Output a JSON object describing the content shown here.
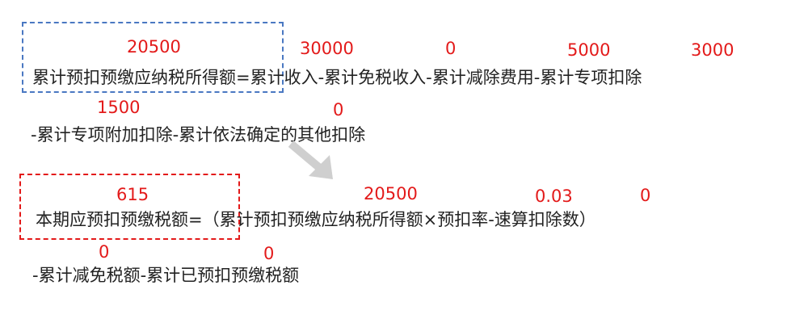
{
  "formula1": {
    "line1": "累计预扣预缴应纳税所得额=累计收入-累计免税收入-累计减除费用-累计专项扣除",
    "line2": "-累计专项附加扣除-累计依法确定的其他扣除",
    "values": {
      "taxable_income": "20500",
      "cumulative_income": "30000",
      "tax_free_income": "0",
      "deduction_expenses": "5000",
      "special_deduction": "3000",
      "special_additional_deduction": "1500",
      "other_deduction": "0"
    }
  },
  "formula2": {
    "line1": "本期应预扣预缴税额=（累计预扣预缴应纳税所得额×预扣率-速算扣除数）",
    "line2": "-累计减免税额-累计已预扣预缴税额",
    "values": {
      "current_tax": "615",
      "taxable_income": "20500",
      "withholding_rate": "0.03",
      "quick_deduction": "0",
      "tax_reduction": "0",
      "prepaid_tax": "0"
    }
  },
  "colors": {
    "value_text": "#e31a1a",
    "formula_text": "#222222",
    "box1_border": "#4a78c2",
    "box2_border": "#e31a1a",
    "arrow": "#cccccc"
  },
  "icons": {
    "arrow": "arrow-down-right-icon"
  }
}
